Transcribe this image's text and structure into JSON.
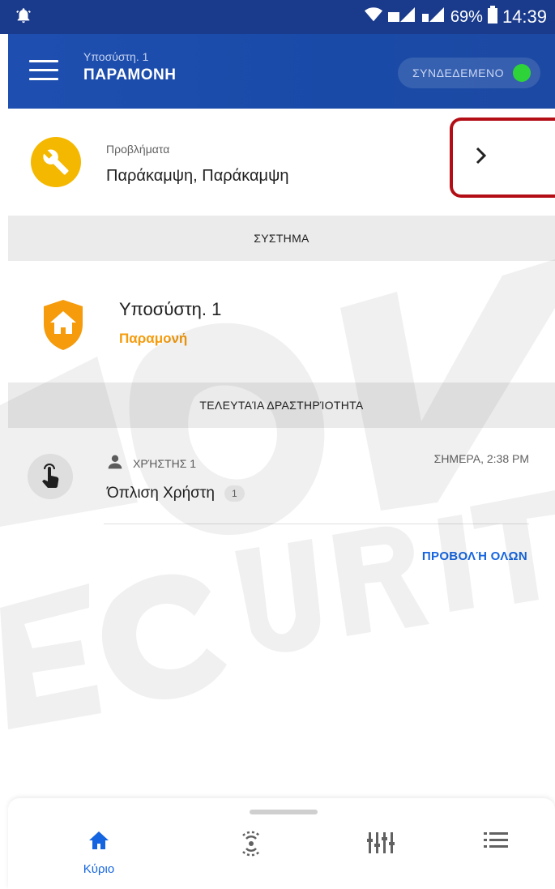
{
  "statusbar": {
    "battery": "69%",
    "time": "14:39"
  },
  "header": {
    "subtitle": "Υποσύστη. 1",
    "title": "ΠΑΡΑΜΟΝΗ",
    "connection_label": "ΣΥΝΔΕΔΕΜΕΝΟ",
    "connection_color": "#2ed33a",
    "accent": "#1e4fb0"
  },
  "problems": {
    "label": "Προβλήματα",
    "value": "Παράκαμψη, Παράκαμψη",
    "icon": "wrench-icon",
    "icon_color": "#f5b800"
  },
  "system_section": {
    "header": "ΣΥΣΤΗΜΑ",
    "partition_name": "Υποσύστη. 1",
    "partition_state": "Παραμονή",
    "state_color": "#f59b0c",
    "icon": "home-shield-icon"
  },
  "activity_section": {
    "header": "ΤΕΛΕΥΤΑΊΑ ΔΡΑΣΤΗΡΊΟΤΗΤΑ",
    "items": [
      {
        "user": "ΧΡΉΣΤΗΣ 1",
        "time": "ΣΗΜΕΡΑ, 2:38 PM",
        "event": "Όπλιση Χρήστη",
        "count": "1",
        "icon": "touch-icon"
      }
    ],
    "view_all": "ΠΡΟΒΟΛΉ ΟΛΩΝ"
  },
  "bottom_nav": {
    "items": [
      {
        "label": "Κύριο",
        "icon": "home-icon",
        "active": true
      },
      {
        "label": "",
        "icon": "sensor-icon",
        "active": false
      },
      {
        "label": "",
        "icon": "equalizer-icon",
        "active": false
      },
      {
        "label": "",
        "icon": "list-icon",
        "active": false
      }
    ],
    "active_color": "#1565e0"
  }
}
